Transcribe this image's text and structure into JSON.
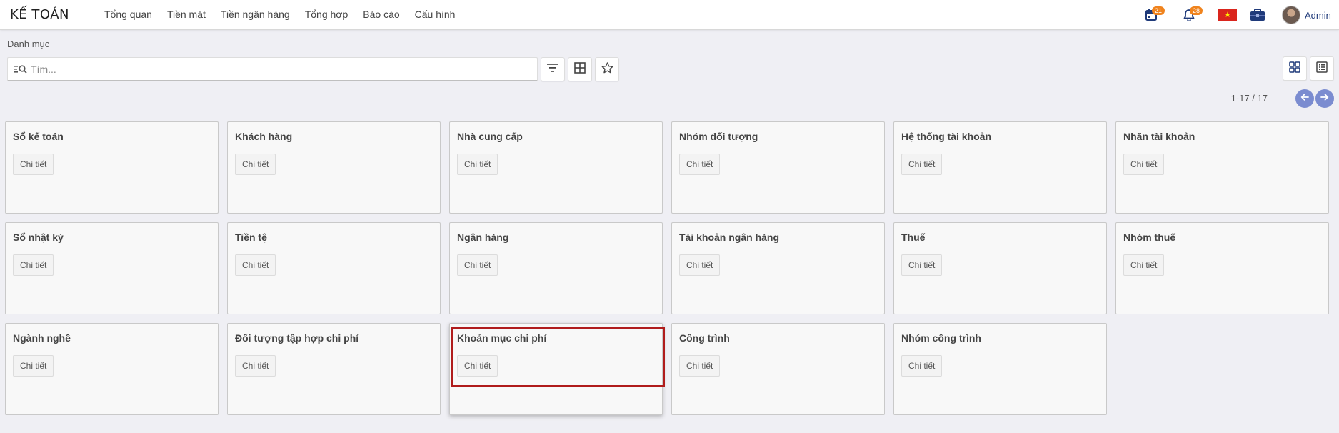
{
  "app": {
    "title": "KẾ TOÁN"
  },
  "nav": [
    "Tổng quan",
    "Tiền mặt",
    "Tiền ngân hàng",
    "Tổng hợp",
    "Báo cáo",
    "Cấu hình"
  ],
  "systray": {
    "activity_badge": "21",
    "notification_badge": "28",
    "flag_icon": "vietnam-flag",
    "user_name": "Admin"
  },
  "breadcrumb": "Danh mục",
  "search": {
    "placeholder": "Tìm...",
    "value": ""
  },
  "pager": {
    "text": "1-17 / 17"
  },
  "cards": [
    {
      "title": "Sổ kế toán",
      "button": "Chi tiết"
    },
    {
      "title": "Khách hàng",
      "button": "Chi tiết"
    },
    {
      "title": "Nhà cung cấp",
      "button": "Chi tiết"
    },
    {
      "title": "Nhóm đối tượng",
      "button": "Chi tiết"
    },
    {
      "title": "Hệ thống tài khoản",
      "button": "Chi tiết"
    },
    {
      "title": "Nhãn tài khoản",
      "button": "Chi tiết"
    },
    {
      "title": "Sổ nhật ký",
      "button": "Chi tiết"
    },
    {
      "title": "Tiền tệ",
      "button": "Chi tiết"
    },
    {
      "title": "Ngân hàng",
      "button": "Chi tiết"
    },
    {
      "title": "Tài khoản ngân hàng",
      "button": "Chi tiết"
    },
    {
      "title": "Thuế",
      "button": "Chi tiết"
    },
    {
      "title": "Nhóm thuế",
      "button": "Chi tiết"
    },
    {
      "title": "Ngành nghề",
      "button": "Chi tiết"
    },
    {
      "title": "Đối tượng tập hợp chi phí",
      "button": "Chi tiết"
    },
    {
      "title": "Khoản mục chi phí",
      "button": "Chi tiết"
    },
    {
      "title": "Công trình",
      "button": "Chi tiết"
    },
    {
      "title": "Nhóm công trình",
      "button": "Chi tiết"
    }
  ],
  "colors": {
    "accent": "#7b8cd0",
    "badge": "#f0831d",
    "highlight": "#b01c1c",
    "brand_nav": "#1f3a7a"
  }
}
